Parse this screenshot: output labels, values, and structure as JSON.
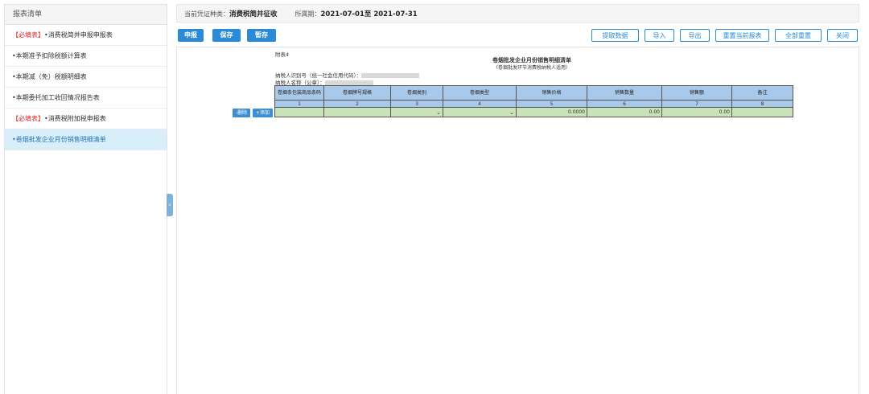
{
  "sidebar": {
    "title": "报表清单",
    "items": [
      {
        "tag": "【必填表】",
        "label": "•消费税简并申报申报表"
      },
      {
        "tag": "",
        "label": "•本期准予扣除税额计算表"
      },
      {
        "tag": "",
        "label": "•本期减（免）税额明细表"
      },
      {
        "tag": "",
        "label": "•本期委托加工收回情况报告表"
      },
      {
        "tag": "【必填表】",
        "label": "•消费税附加税申报表"
      },
      {
        "tag": "",
        "label": "•卷烟批发企业月份销售明细清单"
      }
    ],
    "collapse_glyph": "‹"
  },
  "infobar": {
    "category_label": "当前凭证种类：",
    "category_value": "消费税简并征收",
    "period_label": "所属期：",
    "period_value": "2021-07-01至 2021-07-31"
  },
  "toolbar": {
    "declare": "申报",
    "save": "保存",
    "temp_save": "暂存",
    "fetch": "提取数据",
    "import": "导入",
    "export": "导出",
    "reset_current": "重置当前报表",
    "reset_all": "全部重置",
    "close": "关闭"
  },
  "form": {
    "attachment": "附表4",
    "title": "卷烟批发企业月份销售明细清单",
    "subtitle": "（卷烟批发环节消费税纳税人适用）",
    "taxpayer_id_label": "纳税人识别号（统一社会信用代码）：",
    "taxpayer_name_label": "纳税人名称（公章）：",
    "delete_row": "-删除",
    "add_row": "+添加",
    "columns": [
      "卷烟条包装商品条码",
      "卷烟牌号规格",
      "卷烟类别",
      "卷烟类型",
      "销售价格",
      "销售数量",
      "销售额",
      "备注"
    ],
    "column_numbers": [
      "1",
      "2",
      "3",
      "4",
      "5",
      "6",
      "7",
      "8"
    ],
    "row": {
      "barcode": "",
      "brand_spec": "",
      "category": "",
      "type": "",
      "price": "0.0000",
      "quantity": "0.00",
      "amount": "0.00",
      "remark": ""
    },
    "dropdown_glyph": "⌄"
  }
}
